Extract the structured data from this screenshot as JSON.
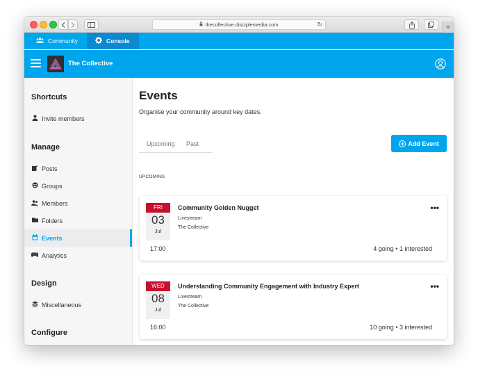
{
  "browser": {
    "url": "thecollective.disciplemedia.com"
  },
  "top_tabs": [
    {
      "label": "Community",
      "icon": "users-icon"
    },
    {
      "label": "Console",
      "icon": "gear-icon",
      "active": true
    }
  ],
  "app": {
    "title": "The Collective"
  },
  "sidebar": {
    "sections": [
      {
        "title": "Shortcuts",
        "items": [
          {
            "label": "Invite members",
            "icon": "user-icon"
          }
        ]
      },
      {
        "title": "Manage",
        "items": [
          {
            "label": "Posts",
            "icon": "edit-icon"
          },
          {
            "label": "Groups",
            "icon": "groups-icon"
          },
          {
            "label": "Members",
            "icon": "members-icon"
          },
          {
            "label": "Folders",
            "icon": "folder-icon"
          },
          {
            "label": "Events",
            "icon": "calendar-icon",
            "active": true
          },
          {
            "label": "Analytics",
            "icon": "gamepad-icon"
          }
        ]
      },
      {
        "title": "Design",
        "items": [
          {
            "label": "Miscellaneous",
            "icon": "layers-icon"
          }
        ]
      },
      {
        "title": "Configure",
        "items": []
      }
    ]
  },
  "main": {
    "title": "Events",
    "subtitle": "Organise your community around key dates.",
    "tabs": [
      "Upcoming",
      "Past"
    ],
    "add_button": "Add Event",
    "section_label": "UPCOMING",
    "events": [
      {
        "dow": "FRI",
        "day": "03",
        "month": "Jul",
        "title": "Community Golden Nugget",
        "type": "Livestream",
        "host": "The Collective",
        "time": "17:00",
        "stats": "4 going • 1 interested"
      },
      {
        "dow": "WED",
        "day": "08",
        "month": "Jul",
        "title": "Understanding Community Engagement with Industry Expert",
        "type": "Livestream",
        "host": "The Collective",
        "time": "16:00",
        "stats": "10 going • 3 interested"
      }
    ]
  },
  "colors": {
    "brand_blue": "#00a6ed",
    "console_tab": "#0b8ad1",
    "date_red": "#c8102e"
  }
}
